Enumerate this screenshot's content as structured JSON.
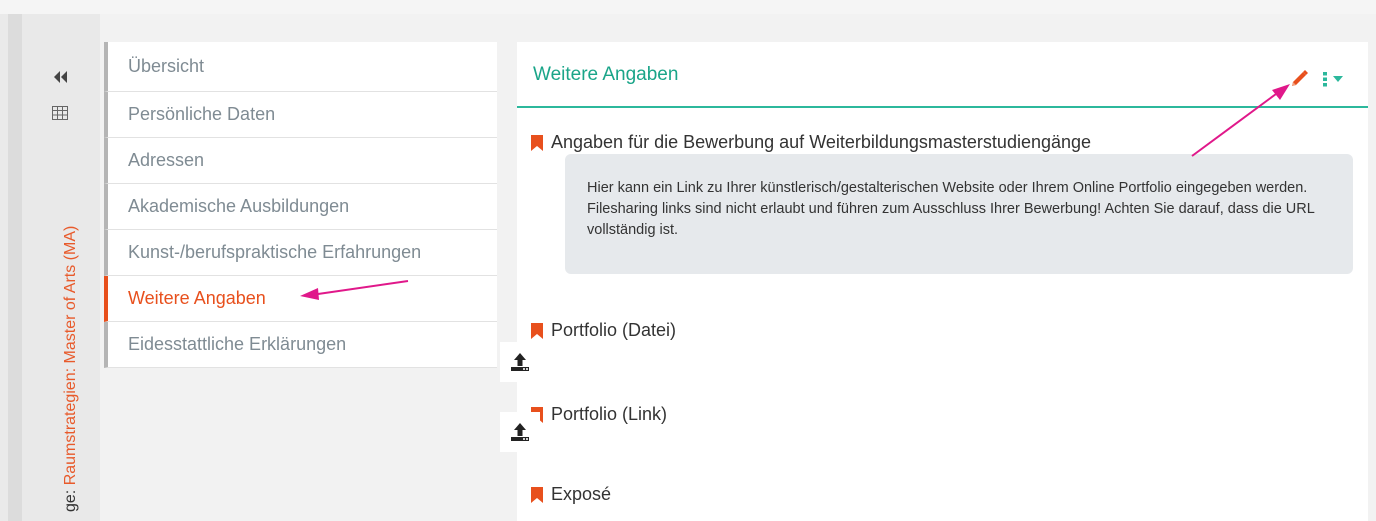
{
  "sidebar": {
    "vertical_label_prefix": "ge:",
    "vertical_label_value": "Raumstrategien: Master of Arts (MA)"
  },
  "nav": {
    "items": [
      {
        "label": "Übersicht"
      },
      {
        "label": "Persönliche Daten"
      },
      {
        "label": "Adressen"
      },
      {
        "label": "Akademische Ausbildungen"
      },
      {
        "label": "Kunst-/berufspraktische Erfahrungen"
      },
      {
        "label": "Weitere Angaben"
      },
      {
        "label": "Eidesstattliche Erklärungen"
      }
    ],
    "active_index": 5
  },
  "main": {
    "title": "Weitere Angaben",
    "sections": [
      {
        "title": "Angaben für die Bewerbung auf Weiterbildungsmasterstudiengänge"
      },
      {
        "title": "Portfolio (Datei)"
      },
      {
        "title": "Portfolio (Link)"
      },
      {
        "title": "Exposé"
      }
    ],
    "info_text": "Hier kann ein Link zu Ihrer künstlerisch/gestalterischen Website oder Ihrem Online Portfolio eingegeben werden. Filesharing links sind nicht erlaubt und führen zum Ausschluss Ihrer Bewerbung! Achten Sie darauf, dass die URL vollständig ist."
  },
  "icons": {
    "collapse": "double-chevron-left-icon",
    "grid": "table-grid-icon",
    "edit": "pencil-icon",
    "menu": "vertical-dots-menu-icon",
    "upload": "upload-icon",
    "bookmark": "bookmark-icon"
  },
  "colors": {
    "accent_orange": "#e8501d",
    "accent_green": "#1aa589",
    "annotation_arrow": "#e0188a",
    "info_box_bg": "#e6e9ec"
  }
}
